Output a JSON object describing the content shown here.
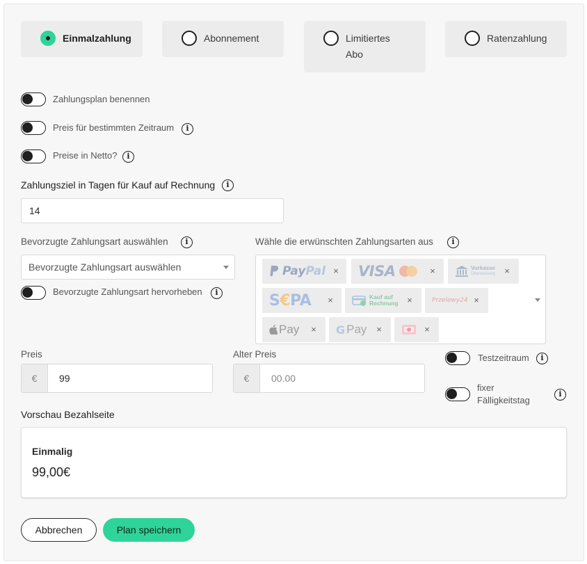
{
  "colors": {
    "accent": "#2ed49a",
    "panel_bg": "#f7f7f7",
    "card_bg": "#ececec"
  },
  "plan_types": [
    {
      "label": "Einmalzahlung",
      "selected": true
    },
    {
      "label": "Abonnement",
      "selected": false
    },
    {
      "label": "Limitiertes Abo",
      "selected": false
    },
    {
      "label": "Ratenzahlung",
      "selected": false
    }
  ],
  "toggles": {
    "name_plan": {
      "label": "Zahlungsplan benennen",
      "on": false
    },
    "price_period": {
      "label": "Preis für bestimmten Zeitraum",
      "on": false
    },
    "net_prices": {
      "label": "Preise in Netto?",
      "on": false
    },
    "highlight_payment": {
      "label": "Bevorzugte Zahlungsart hervorheben",
      "on": false
    },
    "trial": {
      "label": "Testzeitraum",
      "on": false
    },
    "fixed_due": {
      "label": "fixer Fälligkeitstag",
      "on": false
    }
  },
  "invoice_term": {
    "label": "Zahlungsziel in Tagen für Kauf auf Rechnung",
    "value": "14"
  },
  "preferred_method": {
    "label": "Bevorzugte Zahlungsart auswählen",
    "placeholder": "Bevorzugte Zahlungsart auswählen"
  },
  "payment_methods": {
    "label": "Wähle die erwünschten Zahlungsarten aus",
    "chips": [
      {
        "name": "PayPal",
        "icon": "paypal-logo"
      },
      {
        "name": "VISA",
        "icon": "visa-mastercard-logo"
      },
      {
        "name": "Vorkasse Überweisung",
        "icon": "bank-transfer-logo"
      },
      {
        "name": "SEPA",
        "icon": "sepa-logo"
      },
      {
        "name": "Kauf auf Rechnung",
        "icon": "invoice-logo"
      },
      {
        "name": "Przelewy24",
        "icon": "przelewy24-logo"
      },
      {
        "name": "Pay",
        "icon": "apple-pay-logo"
      },
      {
        "name": "Pay",
        "icon": "google-pay-logo"
      },
      {
        "name": "",
        "icon": "card-logo"
      }
    ],
    "remove_glyph": "×"
  },
  "price": {
    "label": "Preis",
    "currency": "€",
    "value": "99"
  },
  "old_price": {
    "label": "Alter Preis",
    "currency": "€",
    "placeholder": "00.00"
  },
  "preview": {
    "title": "Vorschau Bezahlseite",
    "type": "Einmalig",
    "amount": "99,00€"
  },
  "buttons": {
    "cancel": "Abbrechen",
    "save": "Plan speichern"
  }
}
